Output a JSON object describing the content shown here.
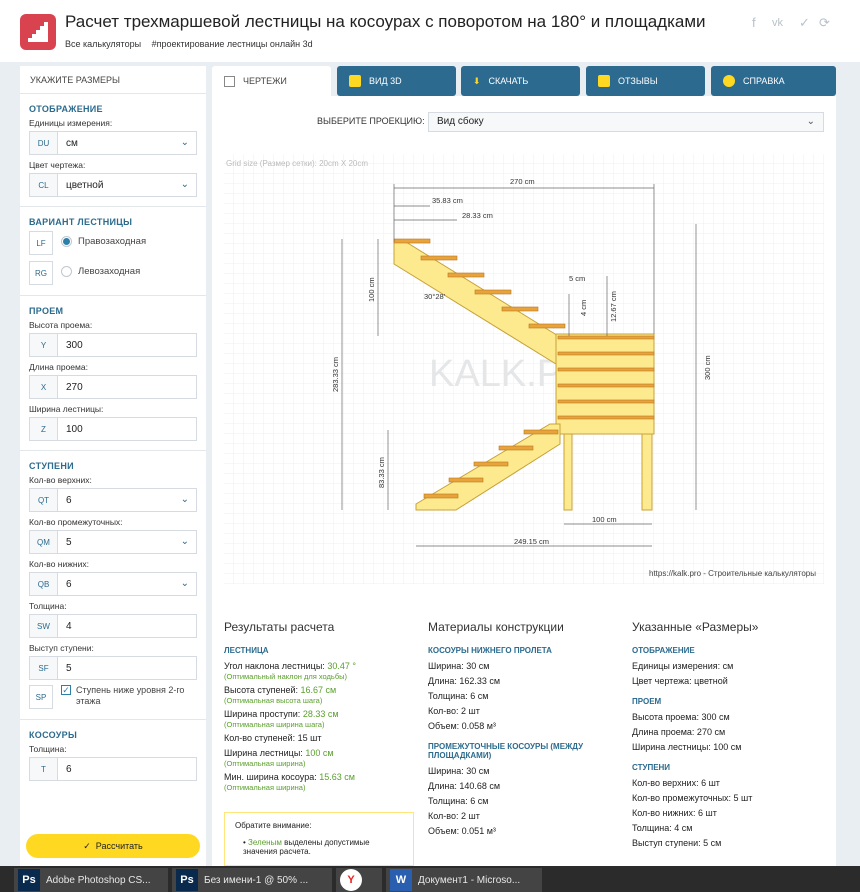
{
  "header": {
    "title": "Расчет трехмаршевой лестницы на косоурах с поворотом на 180° и площадками",
    "breadcrumbs": [
      "Все калькуляторы",
      "#проектирование лестницы онлайн 3d"
    ],
    "social": [
      "f",
      "vk",
      "tw",
      "share"
    ]
  },
  "sidebar": {
    "head": "УКАЖИТЕ РАЗМЕРЫ",
    "display": {
      "title": "ОТОБРАЖЕНИЕ",
      "units_label": "Единицы измерения:",
      "units_prefix": "DU",
      "units_value": "см",
      "color_label": "Цвет чертежа:",
      "color_prefix": "CL",
      "color_value": "цветной"
    },
    "variant": {
      "title": "ВАРИАНТ ЛЕСТНИЦЫ",
      "lf": "LF",
      "rg": "RG",
      "right": "Правозаходная",
      "left": "Левозаходная"
    },
    "opening": {
      "title": "ПРОЕМ",
      "height_label": "Высота проема:",
      "height_prefix": "Y",
      "height_value": "300",
      "length_label": "Длина проема:",
      "length_prefix": "X",
      "length_value": "270",
      "width_label": "Ширина лестницы:",
      "width_prefix": "Z",
      "width_value": "100"
    },
    "steps": {
      "title": "СТУПЕНИ",
      "top_label": "Кол-во верхних:",
      "top_prefix": "QT",
      "top_value": "6",
      "mid_label": "Кол-во промежуточных:",
      "mid_prefix": "QM",
      "mid_value": "5",
      "bottom_label": "Кол-во нижних:",
      "bottom_prefix": "QB",
      "bottom_value": "6",
      "thick_label": "Толщина:",
      "thick_prefix": "SW",
      "thick_value": "4",
      "overhang_label": "Выступ ступени:",
      "overhang_prefix": "SF",
      "overhang_value": "5",
      "sp_prefix": "SP",
      "sp_check": "Ступень ниже уровня 2-го этажа"
    },
    "stringers": {
      "title": "КОСОУРЫ",
      "thick_label": "Толщина:",
      "thick_prefix": "T",
      "thick_value": "6"
    },
    "calc_button": "Рассчитать"
  },
  "tabs": [
    {
      "label": "ЧЕРТЕЖИ"
    },
    {
      "label": "ВИД 3D"
    },
    {
      "label": "СКАЧАТЬ"
    },
    {
      "label": "ОТЗЫВЫ"
    },
    {
      "label": "СПРАВКА"
    }
  ],
  "projection": {
    "label": "ВЫБЕРИТЕ ПРОЕКЦИЮ:",
    "value": "Вид сбоку"
  },
  "drawing": {
    "grid_size": "Grid size (Размер сетки): 20cm X 20cm",
    "watermark": "KALK.PRO",
    "site": "https://kalk.pro - Строительные калькуляторы",
    "dims": {
      "total_len": "270 cm",
      "d1": "35.83 cm",
      "d2": "28.33 cm",
      "h100": "100 cm",
      "angle": "30°28'",
      "s5": "5 cm",
      "s4": "4 cm",
      "s1267": "12.67 cm",
      "h28333": "283.33 cm",
      "h300": "300 cm",
      "h8333": "83.33 cm",
      "w100": "100 cm",
      "w24915": "249.15 cm"
    }
  },
  "results": {
    "title": "Результаты расчета",
    "sub": "ЛЕСТНИЦА",
    "angle": "Угол наклона лестницы:",
    "angle_v": "30.47 °",
    "angle_s": "(Оптимальный наклон для ходьбы)",
    "rise": "Высота ступеней:",
    "rise_v": "16.67 см",
    "rise_s": "(Оптимальная высота шага)",
    "tread": "Ширина проступи:",
    "tread_v": "28.33 см",
    "tread_s": "(Оптимальная ширина шага)",
    "count": "Кол-во ступеней: 15 шт",
    "width": "Ширина лестницы:",
    "width_v": "100 см",
    "width_s": "(Оптимальная ширина)",
    "minw": "Мин. ширина косоура:",
    "minw_v": "15.63 см",
    "minw_s": "(Оптимальная ширина)",
    "note_title": "Обратите внимание:",
    "note_green": "Зеленым",
    "note_rest": "выделены допустимые значения расчета."
  },
  "materials": {
    "title": "Материалы конструкции",
    "s1": "КОСОУРЫ НИЖНЕГО ПРОЛЕТА",
    "s1_items": [
      "Ширина: 30 см",
      "Длина: 162.33 см",
      "Толщина: 6 см",
      "Кол-во: 2 шт",
      "Объем: 0.058 м³"
    ],
    "s2": "ПРОМЕЖУТОЧНЫЕ КОСОУРЫ (МЕЖДУ ПЛОЩАДКАМИ)",
    "s2_items": [
      "Ширина: 30 см",
      "Длина: 140.68 см",
      "Толщина: 6 см",
      "Кол-во: 2 шт",
      "Объем: 0.051 м³"
    ]
  },
  "specified": {
    "title": "Указанные «Размеры»",
    "s1": "ОТОБРАЖЕНИЕ",
    "s1_items": [
      "Единицы измерения: см",
      "Цвет чертежа: цветной"
    ],
    "s2": "ПРОЕМ",
    "s2_items": [
      "Высота проема: 300 см",
      "Длина проема: 270 см",
      "Ширина лестницы: 100 см"
    ],
    "s3": "СТУПЕНИ",
    "s3_items": [
      "Кол-во верхних: 6 шт",
      "Кол-во промежуточных: 5 шт",
      "Кол-во нижних: 6 шт",
      "Толщина: 4 см",
      "Выступ ступени: 5 см"
    ]
  },
  "taskbar": [
    {
      "icon": "Ps",
      "label": "Adobe Photoshop CS..."
    },
    {
      "icon": "Ps",
      "label": "Без имени-1 @ 50% ..."
    },
    {
      "icon": "Y",
      "label": ""
    },
    {
      "icon": "W",
      "label": "Документ1 - Microso..."
    }
  ]
}
